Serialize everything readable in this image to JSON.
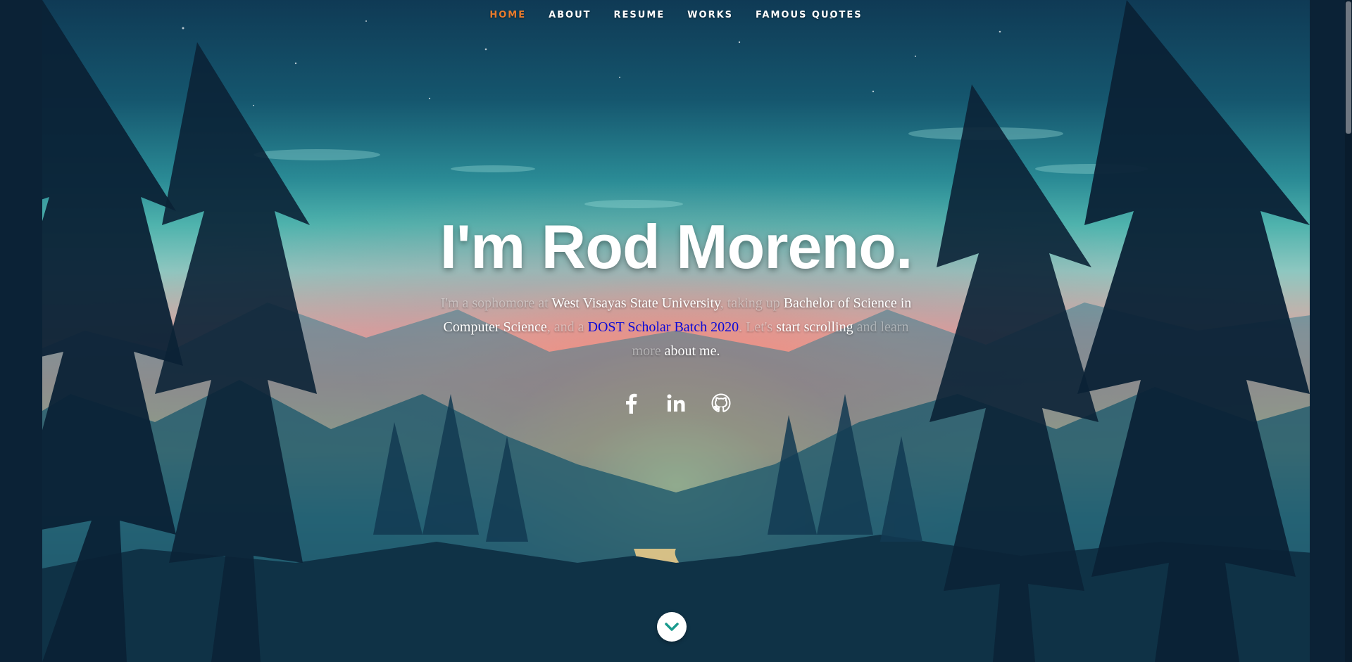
{
  "nav": {
    "items": [
      {
        "label": "HOME",
        "active": true
      },
      {
        "label": "ABOUT",
        "active": false
      },
      {
        "label": "RESUME",
        "active": false
      },
      {
        "label": "WORKS",
        "active": false
      },
      {
        "label": "FAMOUS QUOTES",
        "active": false
      }
    ],
    "active_color": "#e87b2d"
  },
  "banner": {
    "headline": "I'm Rod Moreno.",
    "intro": {
      "p1": "I'm a sophomore at",
      "p2": " West Visayas State University",
      "p3": ", taking up",
      "p4": " Bachelor of Science in Computer Science",
      "p5": ", and a",
      "link": "DOST Scholar Batch 2020",
      "p6": ". Let's",
      "p7": " start scrolling",
      "p8": " and learn more",
      "p9": " about me."
    }
  },
  "social": [
    {
      "icon": "facebook-icon"
    },
    {
      "icon": "linkedin-icon"
    },
    {
      "icon": "github-icon"
    }
  ],
  "scroll_button": {
    "icon": "chevron-down-icon"
  },
  "colors": {
    "link": "#0a0ad8",
    "scroll_button_icon": "#1a9a8e"
  }
}
